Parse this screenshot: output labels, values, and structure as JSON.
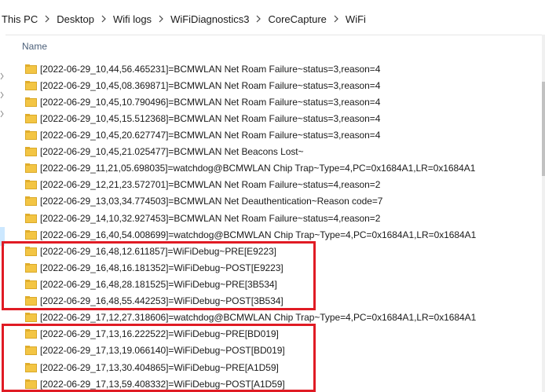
{
  "breadcrumb": [
    {
      "label": "This PC"
    },
    {
      "label": "Desktop"
    },
    {
      "label": "Wifi logs"
    },
    {
      "label": "WiFiDiagnostics3"
    },
    {
      "label": "CoreCapture"
    },
    {
      "label": "WiFi"
    }
  ],
  "column_header": "Name",
  "files": [
    {
      "name": "[2022-06-29_10,44,56.465231]=BCMWLAN Net Roam Failure~status=3,reason=4"
    },
    {
      "name": "[2022-06-29_10,45,08.369871]=BCMWLAN Net Roam Failure~status=3,reason=4"
    },
    {
      "name": "[2022-06-29_10,45,10.790496]=BCMWLAN Net Roam Failure~status=3,reason=4"
    },
    {
      "name": "[2022-06-29_10,45,15.512368]=BCMWLAN Net Roam Failure~status=3,reason=4"
    },
    {
      "name": "[2022-06-29_10,45,20.627747]=BCMWLAN Net Roam Failure~status=3,reason=4"
    },
    {
      "name": "[2022-06-29_10,45,21.025477]=BCMWLAN Net Beacons Lost~"
    },
    {
      "name": "[2022-06-29_11,21,05.698035]=watchdog@BCMWLAN Chip Trap~Type=4,PC=0x1684A1,LR=0x1684A1"
    },
    {
      "name": "[2022-06-29_12,21,23.572701]=BCMWLAN Net Roam Failure~status=4,reason=2"
    },
    {
      "name": "[2022-06-29_13,03,34.774503]=BCMWLAN Net Deauthentication~Reason code=7"
    },
    {
      "name": "[2022-06-29_14,10,32.927453]=BCMWLAN Net Roam Failure~status=4,reason=2"
    },
    {
      "name": "[2022-06-29_16,40,54.008699]=watchdog@BCMWLAN Chip Trap~Type=4,PC=0x1684A1,LR=0x1684A1"
    },
    {
      "name": "[2022-06-29_16,48,12.611857]=WiFiDebug~PRE[E9223]"
    },
    {
      "name": "[2022-06-29_16,48,16.181352]=WiFiDebug~POST[E9223]"
    },
    {
      "name": "[2022-06-29_16,48,28.181525]=WiFiDebug~PRE[3B534]"
    },
    {
      "name": "[2022-06-29_16,48,55.442253]=WiFiDebug~POST[3B534]"
    },
    {
      "name": "[2022-06-29_17,12,27.318606]=watchdog@BCMWLAN Chip Trap~Type=4,PC=0x1684A1,LR=0x1684A1"
    },
    {
      "name": "[2022-06-29_17,13,16.222522]=WiFiDebug~PRE[BD019]"
    },
    {
      "name": "[2022-06-29_17,13,19.066140]=WiFiDebug~POST[BD019]"
    },
    {
      "name": "[2022-06-29_17,13,30.404865]=WiFiDebug~PRE[A1D59]"
    },
    {
      "name": "[2022-06-29_17,13,59.408332]=WiFiDebug~POST[A1D59]"
    }
  ],
  "colors": {
    "highlight": "#e01b24",
    "folder": "#f3c544",
    "header_text": "#4c607a"
  }
}
